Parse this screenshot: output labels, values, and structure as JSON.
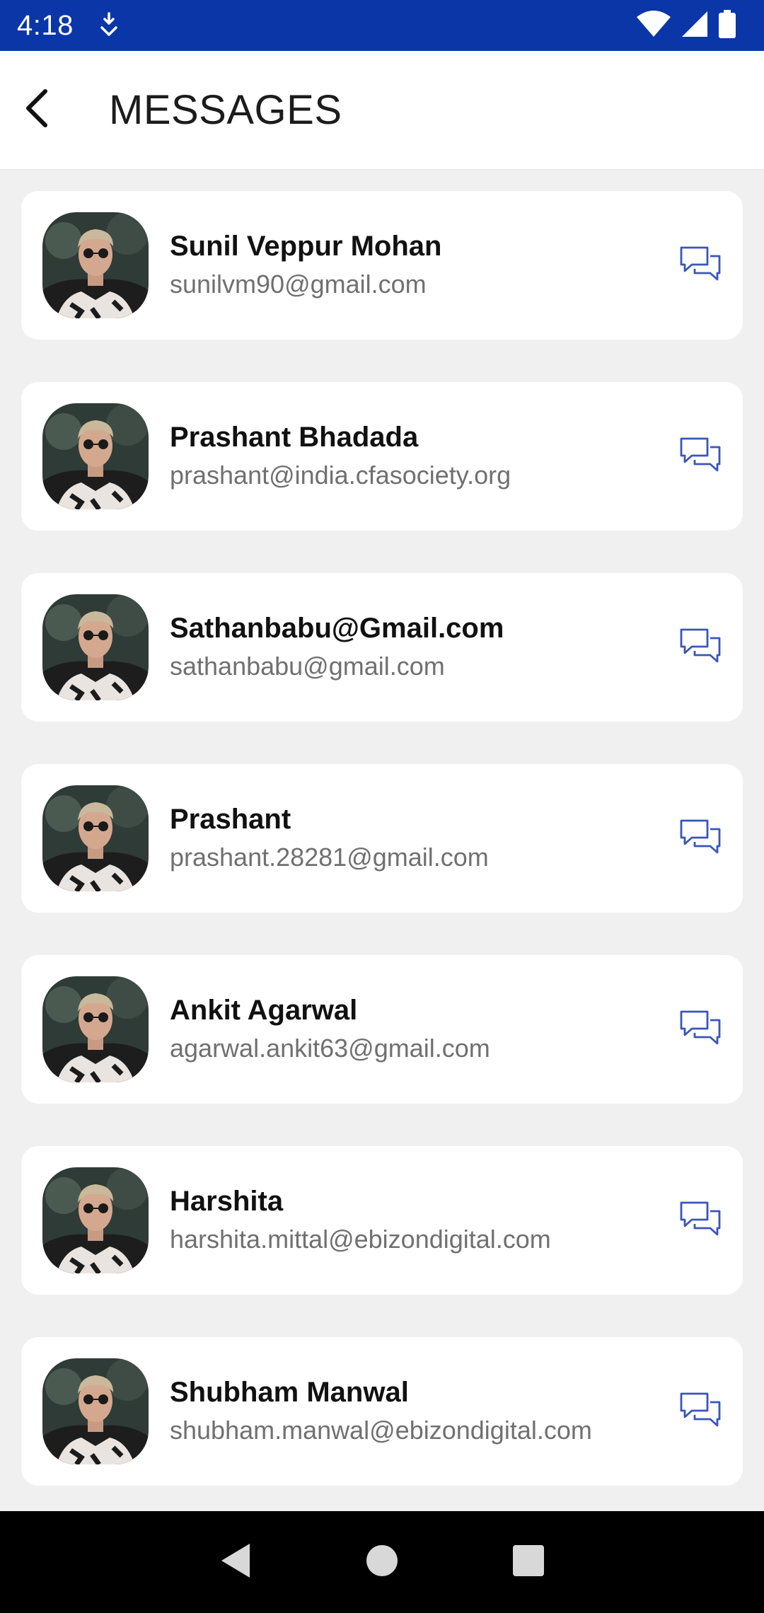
{
  "status_bar": {
    "time": "4:18",
    "icons": [
      "download-indicator-icon",
      "wifi-icon",
      "signal-icon",
      "battery-icon"
    ]
  },
  "header": {
    "title": "MESSAGES",
    "back_icon": "back-arrow-icon"
  },
  "contacts": [
    {
      "name": "Sunil Veppur Mohan",
      "email": "sunilvm90@gmail.com"
    },
    {
      "name": "Prashant Bhadada",
      "email": "prashant@india.cfasociety.org"
    },
    {
      "name": "Sathanbabu@Gmail.com",
      "email": "sathanbabu@gmail.com"
    },
    {
      "name": "Prashant",
      "email": "prashant.28281@gmail.com"
    },
    {
      "name": "Ankit Agarwal",
      "email": "agarwal.ankit63@gmail.com"
    },
    {
      "name": "Harshita",
      "email": "harshita.mittal@ebizondigital.com"
    },
    {
      "name": "Shubham Manwal",
      "email": "shubham.manwal@ebizondigital.com"
    }
  ],
  "nav": {
    "icons": [
      "nav-back-icon",
      "nav-home-icon",
      "nav-recents-icon"
    ]
  },
  "colors": {
    "status_bar": "#0a36a8",
    "chat_icon": "#3a56b8",
    "background": "#f0f0f0"
  }
}
